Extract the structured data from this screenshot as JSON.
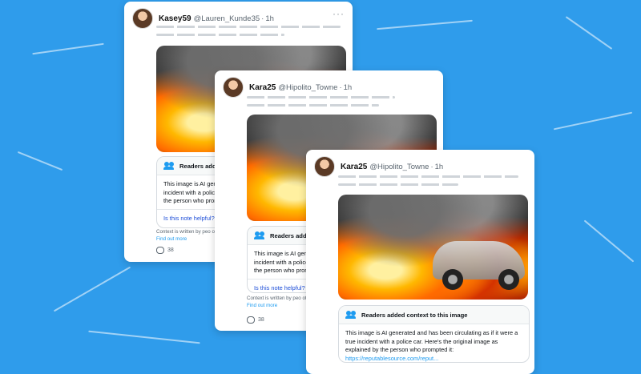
{
  "colors": {
    "background": "#2f9ceb",
    "link": "#1d9bf0"
  },
  "cards": [
    {
      "name": "Kasey59",
      "handle": "@Lauren_Kunde35",
      "separator": "·",
      "time": "1h",
      "note_title": "Readers added co",
      "note_body": "This image is AI gene incident with a police the person who prom",
      "helpful": "Is this note helpful?",
      "footer_text": "Context is written by peo others.",
      "footer_link": "Find out more",
      "reply_count": "38"
    },
    {
      "name": "Kara25",
      "handle": "@Hipolito_Towne",
      "separator": "·",
      "time": "1h",
      "note_title": "Readers added co",
      "note_body": "This image is AI gene incident with a police the person who prom",
      "helpful": "Is this note helpful?",
      "footer_text": "Context is written by peo others.",
      "footer_link": "Find out more",
      "reply_count": "38"
    },
    {
      "name": "Kara25",
      "handle": "@Hipolito_Towne",
      "separator": "·",
      "time": "1h",
      "note_title": "Readers added context to this image",
      "note_body": "This image is AI generated and has been circulating as if it were a true incident with a police car. Here's the original image as explained by the person who prompted it:",
      "note_link": "https://reputablesource.com/reput..."
    }
  ]
}
